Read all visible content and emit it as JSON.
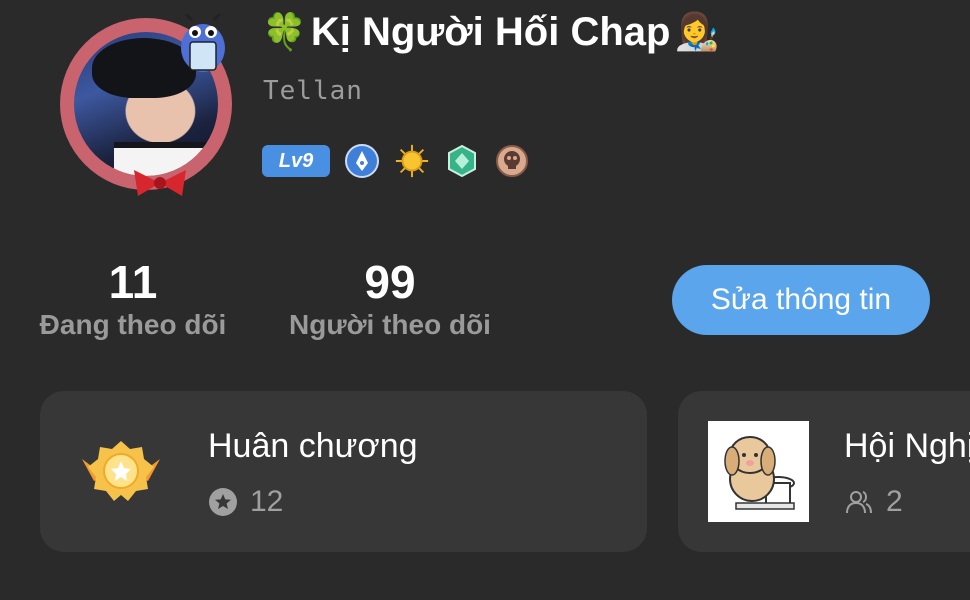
{
  "profile": {
    "name_prefix_emoji": "🍀",
    "name": "Kị Người Hối Chap",
    "name_suffix_emoji": "👩‍🎨",
    "username": "Tellan",
    "level_badge": "Lv9",
    "badge_icons": [
      "pen-nib-badge-icon",
      "sun-badge-icon",
      "green-gem-badge-icon",
      "skull-badge-icon"
    ]
  },
  "stats": {
    "following_count": "11",
    "following_label": "Đang theo dõi",
    "followers_count": "99",
    "followers_label": "Người theo dõi"
  },
  "actions": {
    "edit_label": "Sửa thông tin"
  },
  "cards": {
    "medals": {
      "title": "Huân chương",
      "count": "12",
      "icon": "medal-icon"
    },
    "group": {
      "title": "Hội Nghị",
      "count": "2",
      "icon": "members-icon"
    }
  },
  "colors": {
    "background": "#2a2a2b",
    "card": "#373738",
    "accent_button": "#5aa5ec",
    "level_badge": "#4a90e2",
    "avatar_ring": "#c9646f"
  }
}
